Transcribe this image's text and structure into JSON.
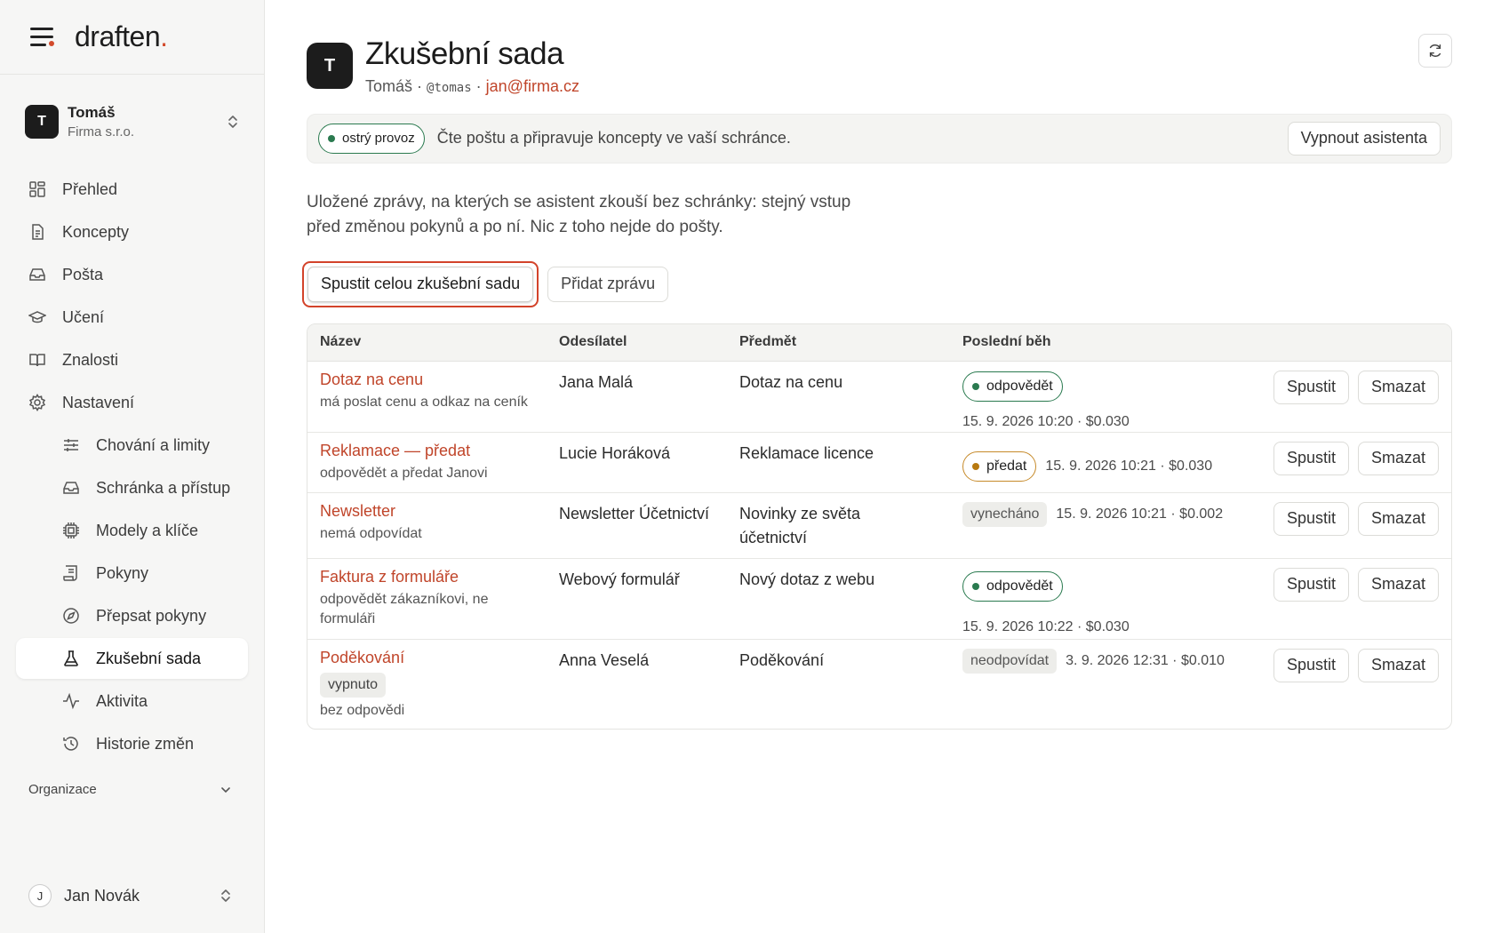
{
  "app": {
    "logo_text": "draften",
    "logo_dot": "."
  },
  "account": {
    "avatar": "T",
    "name": "Tomáš",
    "org": "Firma s.r.o."
  },
  "sidebar": {
    "items": [
      {
        "label": "Přehled",
        "icon": "dashboard-icon"
      },
      {
        "label": "Koncepty",
        "icon": "document-icon"
      },
      {
        "label": "Pošta",
        "icon": "inbox-icon"
      },
      {
        "label": "Učení",
        "icon": "graduation-cap-icon"
      },
      {
        "label": "Znalosti",
        "icon": "book-icon"
      },
      {
        "label": "Nastavení",
        "icon": "gear-icon"
      }
    ],
    "sub_items": [
      {
        "label": "Chování a limity",
        "icon": "sliders-icon"
      },
      {
        "label": "Schránka a přístup",
        "icon": "inbox-icon"
      },
      {
        "label": "Modely a klíče",
        "icon": "chip-icon"
      },
      {
        "label": "Pokyny",
        "icon": "scroll-icon"
      },
      {
        "label": "Přepsat pokyny",
        "icon": "compass-icon"
      },
      {
        "label": "Zkušební sada",
        "icon": "flask-icon"
      },
      {
        "label": "Aktivita",
        "icon": "activity-icon"
      },
      {
        "label": "Historie změn",
        "icon": "history-icon"
      }
    ],
    "section_label": "Organizace",
    "user": {
      "initial": "J",
      "name": "Jan Novák"
    }
  },
  "header": {
    "avatar": "T",
    "title": "Zkušební sada",
    "owner": "Tomáš",
    "sep": "·",
    "handle": "@tomas",
    "email": "jan@firma.cz"
  },
  "banner": {
    "status": "ostrý provoz",
    "text": "Čte poštu a připravuje koncepty ve vaší schránce.",
    "button": "Vypnout asistenta"
  },
  "description": "Uložené zprávy, na kterých se asistent zkouší bez schránky: stejný vstup před změnou pokynů a po ní. Nic z toho nejde do pošty.",
  "actions": {
    "run_all": "Spustit celou zkušební sadu",
    "add": "Přidat zprávu"
  },
  "table": {
    "headers": [
      "Název",
      "Odesílatel",
      "Předmět",
      "Poslední běh"
    ],
    "run_label": "Spustit",
    "delete_label": "Smazat",
    "rows": [
      {
        "title": "Dotaz na cenu",
        "note": "má poslat cenu a odkaz na ceník",
        "sender": "Jana Malá",
        "subject": "Dotaz na cenu",
        "status": "odpovědět",
        "status_kind": "green",
        "run": "15. 9. 2026 10:20 · $0.030"
      },
      {
        "title": "Reklamace — předat",
        "note": "odpovědět a předat Janovi",
        "sender": "Lucie Horáková",
        "subject": "Reklamace licence",
        "status": "předat",
        "status_kind": "orange",
        "run": "15. 9. 2026 10:21 · $0.030"
      },
      {
        "title": "Newsletter",
        "note": "nemá odpovídat",
        "sender": "Newsletter Účetnictví",
        "subject": "Novinky ze světa účetnictví",
        "status": "vynecháno",
        "status_kind": "tag",
        "run": "15. 9. 2026 10:21 · $0.002"
      },
      {
        "title": "Faktura z formuláře",
        "note": "odpovědět zákazníkovi, ne formuláři",
        "sender": "Webový formulář",
        "subject": "Nový dotaz z webu",
        "status": "odpovědět",
        "status_kind": "green",
        "run": "15. 9. 2026 10:22 · $0.030"
      },
      {
        "title": "Poděkování",
        "tag": "vypnuto",
        "note": "bez odpovědi",
        "sender": "Anna Veselá",
        "subject": "Poděkování",
        "status": "neodpovídat",
        "status_kind": "tag",
        "run": "3. 9. 2026 12:31 · $0.010"
      }
    ]
  },
  "colors": {
    "accent": "#c0452a",
    "green": "#2a7a4f",
    "orange": "#c68a2a",
    "highlight": "#d3432a"
  }
}
